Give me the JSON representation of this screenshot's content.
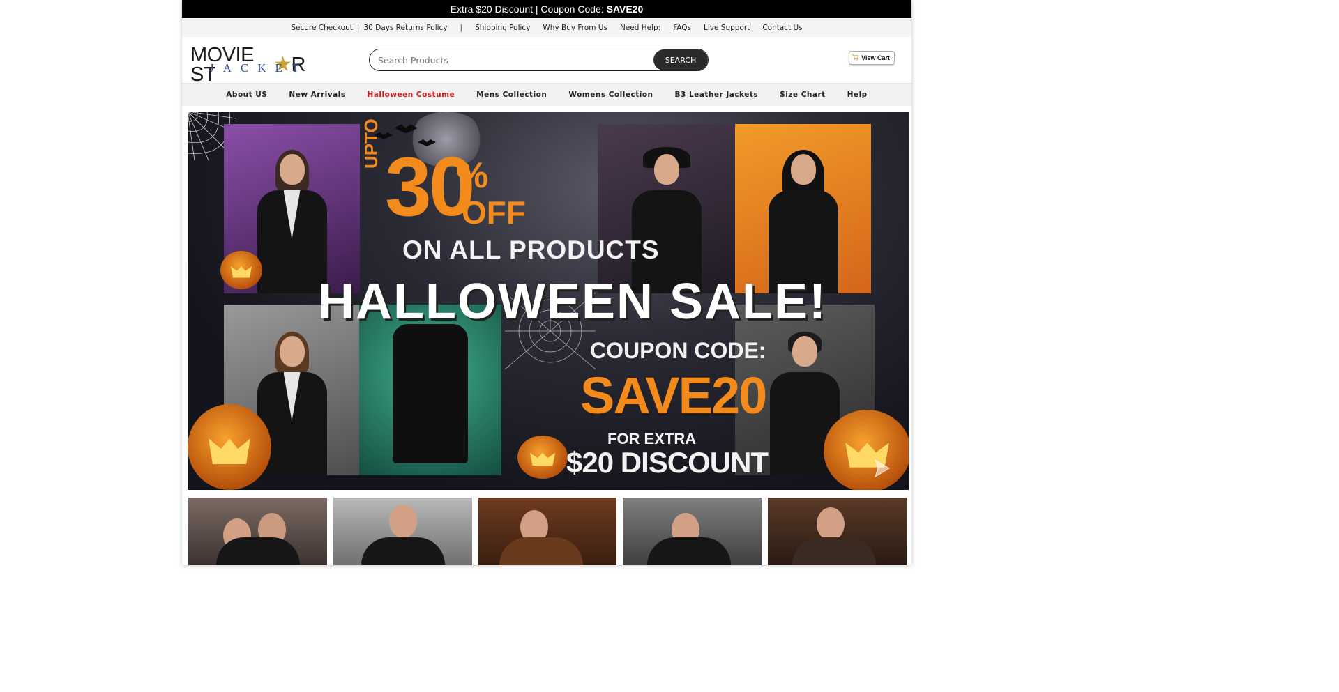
{
  "promo": {
    "text": "Extra $20 Discount | Coupon Code: ",
    "code": "SAVE20"
  },
  "info_bar": {
    "secure_checkout": "Secure Checkout",
    "returns": "30 Days Returns Policy",
    "shipping": "Shipping Policy",
    "why_buy": "Why Buy From Us",
    "need_help": "Need Help:",
    "faqs": "FAQs",
    "live_support": "Live Support",
    "contact_us": "Contact Us",
    "separator": "|"
  },
  "header": {
    "logo_line1_a": "MOVIE ST",
    "logo_star": "★",
    "logo_line1_b": "R",
    "logo_line2": "JACKET",
    "search_placeholder": "Search Products",
    "search_button": "SEARCH",
    "cart_label": "View Cart"
  },
  "nav": {
    "items": [
      {
        "label": "About US"
      },
      {
        "label": "New Arrivals"
      },
      {
        "label": "Halloween Costume",
        "highlight_color": "#d11a1a"
      },
      {
        "label": "Mens Collection"
      },
      {
        "label": "Womens Collection"
      },
      {
        "label": "B3 Leather Jackets"
      },
      {
        "label": "Size Chart"
      },
      {
        "label": "Help"
      }
    ]
  },
  "banner": {
    "upto": "UPTO",
    "percent": "30",
    "percent_sign": "%",
    "off": "OFF",
    "on_all": "ON ALL PRODUCTS",
    "headline": "HALLOWEEN SALE!",
    "coupon_label": "COUPON CODE:",
    "coupon_code": "SAVE20",
    "for_extra": "FOR EXTRA",
    "discount": "$20 DISCOUNT",
    "accent_color": "#f28a1c"
  },
  "icons": {
    "cart": "cart-icon",
    "next": "next-arrow-icon",
    "search": "search-icon"
  }
}
